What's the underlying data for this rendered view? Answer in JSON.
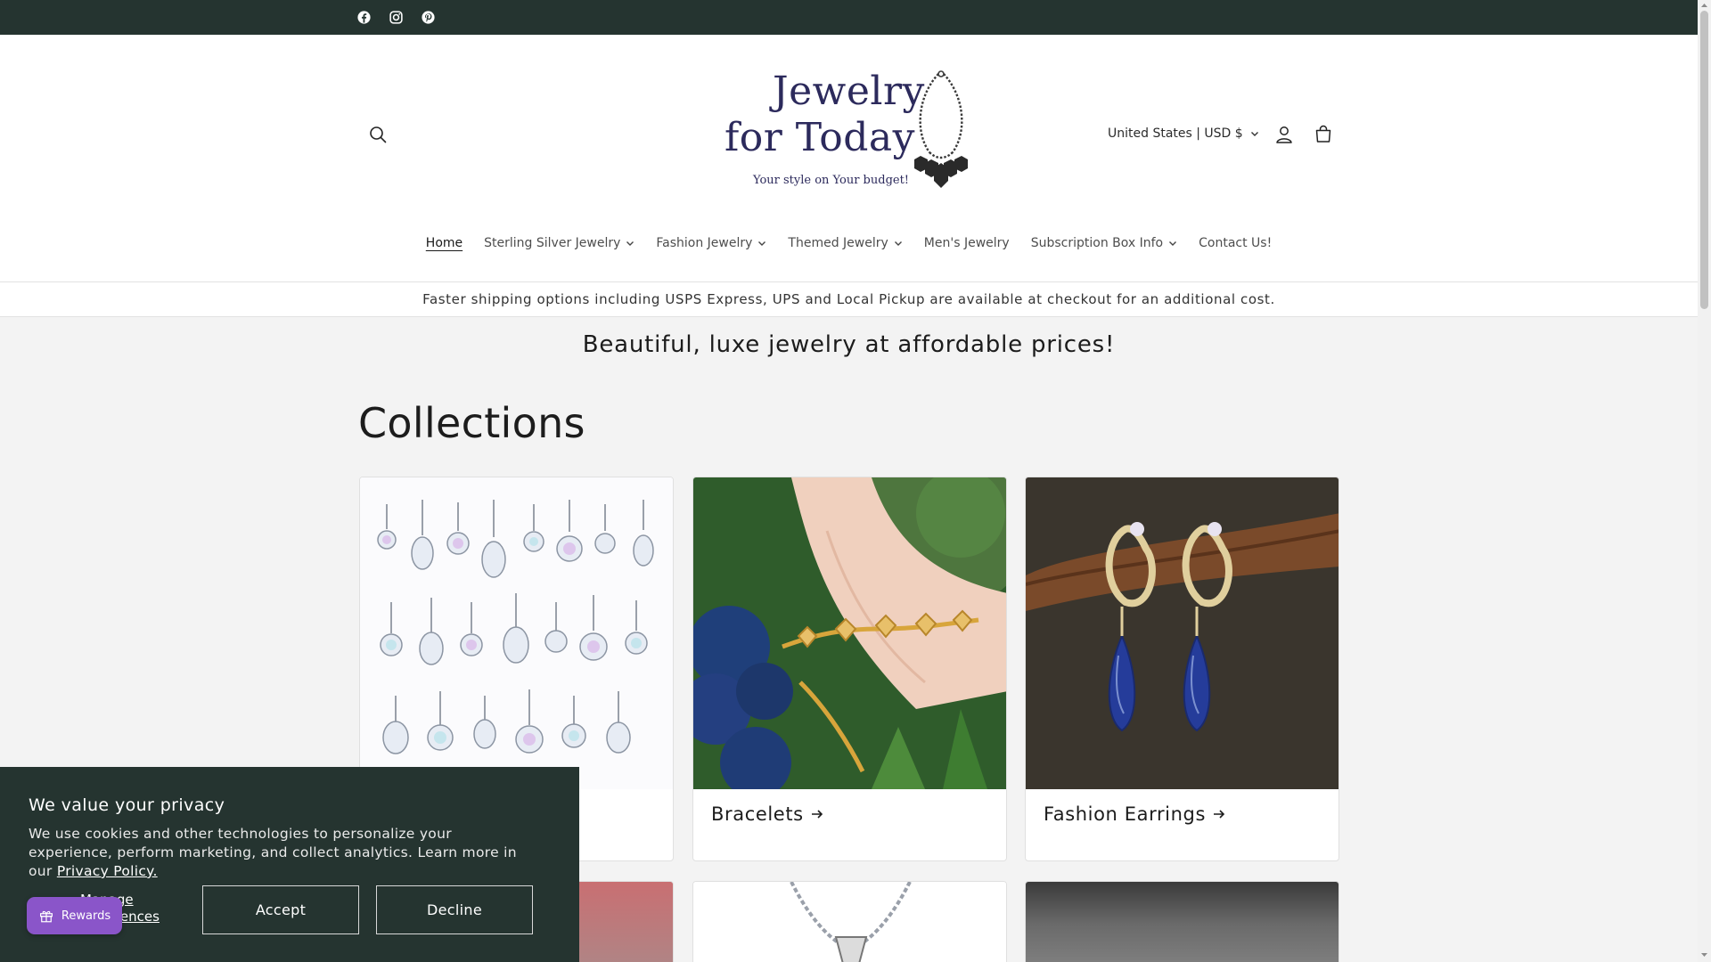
{
  "topbar": {
    "social": [
      {
        "name": "facebook",
        "icon": "facebook-icon"
      },
      {
        "name": "instagram",
        "icon": "instagram-icon"
      },
      {
        "name": "pinterest",
        "icon": "pinterest-icon"
      }
    ]
  },
  "header": {
    "logo": {
      "line1": "Jewelry",
      "line2": "for Today",
      "tagline": "Your style on Your budget!"
    },
    "currency": "United States | USD $",
    "icons": [
      "search-icon",
      "account-icon",
      "cart-icon"
    ]
  },
  "nav": {
    "items": [
      {
        "label": "Home",
        "active": true,
        "dropdown": false
      },
      {
        "label": "Sterling Silver Jewelry",
        "active": false,
        "dropdown": true
      },
      {
        "label": "Fashion Jewelry",
        "active": false,
        "dropdown": true
      },
      {
        "label": "Themed Jewelry",
        "active": false,
        "dropdown": true
      },
      {
        "label": "Men's Jewelry",
        "active": false,
        "dropdown": false
      },
      {
        "label": "Subscription Box Info",
        "active": false,
        "dropdown": true
      },
      {
        "label": "Contact Us!",
        "active": false,
        "dropdown": false
      }
    ]
  },
  "announcement": "Faster shipping options including USPS Express, UPS and Local Pickup are available at checkout for an additional cost.",
  "tagline": "Beautiful, luxe jewelry at affordable prices!",
  "collections": {
    "title": "Collections",
    "cards": [
      {
        "label": "",
        "image": "belly-rings-photo"
      },
      {
        "label": "Bracelets",
        "image": "bracelet-photo"
      },
      {
        "label": "Fashion Earrings",
        "image": "earrings-photo"
      }
    ]
  },
  "privacy": {
    "title": "We value your privacy",
    "body": "We use cookies and other technologies to personalize your experience, perform marketing, and collect analytics. Learn more in our",
    "link": "Privacy Policy.",
    "manage_line1": "Manage",
    "manage_line2": "preferences",
    "accept": "Accept",
    "decline": "Decline"
  },
  "rewards": {
    "label": "Rewards"
  },
  "colors": {
    "topbar": "#253430",
    "logo": "#2c2a5c",
    "rewards": "#8a55c9"
  }
}
